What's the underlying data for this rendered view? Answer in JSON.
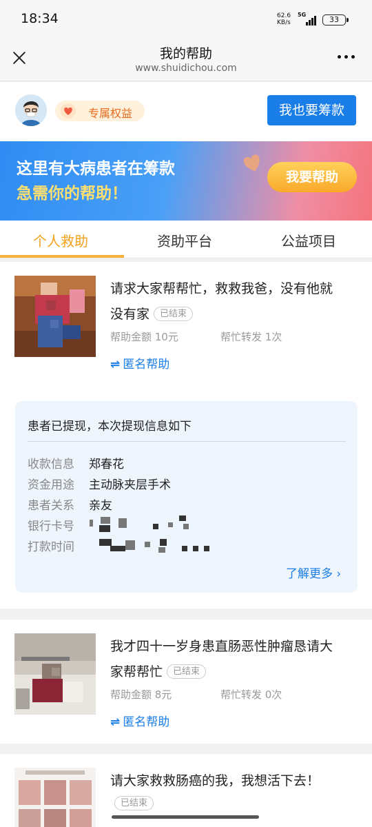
{
  "status_bar": {
    "time": "18:34",
    "net_speed_value": "62.6",
    "net_speed_unit": "KB/s",
    "network_type": "5G",
    "battery": "33"
  },
  "nav": {
    "title": "我的帮助",
    "url": "www.shuidichou.com",
    "close_icon": "close-icon",
    "more_icon": "more-icon"
  },
  "profile": {
    "benefit_label": "专属权益",
    "raise_button": "我也要筹款"
  },
  "banner": {
    "line1": "这里有大病患者在筹款",
    "line2": "急需你的帮助！",
    "help_button": "我要帮助"
  },
  "tabs": [
    {
      "label": "个人救助",
      "active": true
    },
    {
      "label": "资助平台",
      "active": false
    },
    {
      "label": "公益项目",
      "active": false
    }
  ],
  "cards": [
    {
      "title": "请求大家帮帮忙，救救我爸，没有他就没有家",
      "title_line1": "请求大家帮帮忙，救救我爸，没有他就",
      "title_line2": "没有家",
      "status": "已结束",
      "amount": "帮助金额 10元",
      "shares": "帮忙转发 1次",
      "anon": "匿名帮助"
    },
    {
      "title": "我才四十一岁身患直肠恶性肿瘤恳请大家帮帮忙",
      "title_line1": "我才四十一岁身患直肠恶性肿瘤恳请大",
      "title_line2": "家帮帮忙",
      "status": "已结束",
      "amount": "帮助金额 8元",
      "shares": "帮忙转发 0次",
      "anon": "匿名帮助"
    },
    {
      "title": "请大家救救肠癌的我，我想活下去！",
      "status": "已结束"
    }
  ],
  "withdrawal": {
    "title": "患者已提现，本次提现信息如下",
    "rows": [
      {
        "label": "收款信息",
        "value": "郑春花"
      },
      {
        "label": "资金用途",
        "value": "主动脉夹层手术"
      },
      {
        "label": "患者关系",
        "value": "亲友"
      },
      {
        "label": "银行卡号",
        "value": ""
      },
      {
        "label": "打款时间",
        "value": ""
      }
    ],
    "learn_more": "了解更多"
  },
  "colors": {
    "accent_blue": "#1a7ee8",
    "tab_active": "#f2a21b",
    "badge_orange": "#e46a1d"
  }
}
